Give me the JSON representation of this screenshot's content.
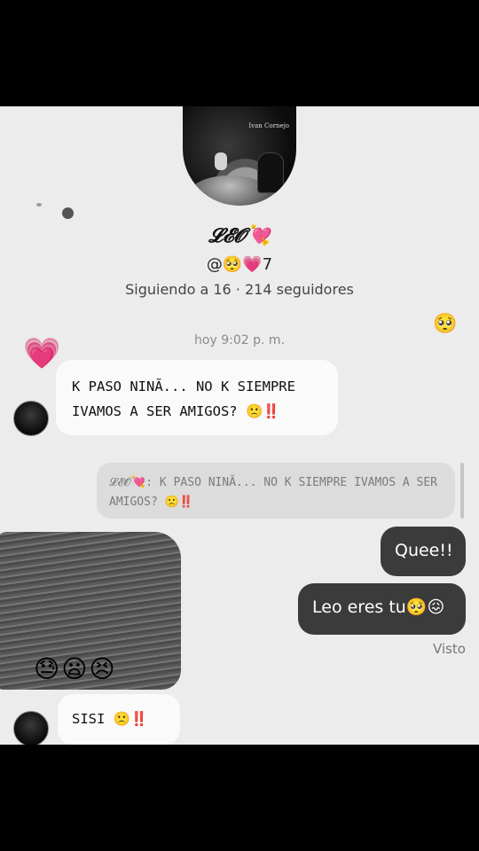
{
  "profile": {
    "avatar_caption": "Ivan Cornejo",
    "name": "𝓛𝓔𝓞💘",
    "handle": "@🥺💗7",
    "stats": "Siguiendo a 16 · 214 seguidores"
  },
  "decor": {
    "pleading_emoji": "🥺",
    "heart_emoji": "💗"
  },
  "chat": {
    "timestamp": "hoy 9:02 p. m.",
    "messages": [
      {
        "from": "them",
        "text": "K PASO NINÃ... NO K SIEMPRE IVAMOS A SER AMIGOS? 🙁‼️"
      },
      {
        "from": "reply_preview",
        "text": "𝓛𝓔𝓞💘: K PASO NINÃ... NO K SIEMPRE IVAMOS A SER AMIGOS? 🙁‼️"
      },
      {
        "from": "me",
        "text": "Quee!!"
      },
      {
        "from": "me",
        "text": "Leo eres tu🥺😖"
      },
      {
        "from": "them",
        "text": "SISI 🙁‼️"
      }
    ],
    "seen": "Visto",
    "reaction_emojis": "😓😦😣"
  }
}
